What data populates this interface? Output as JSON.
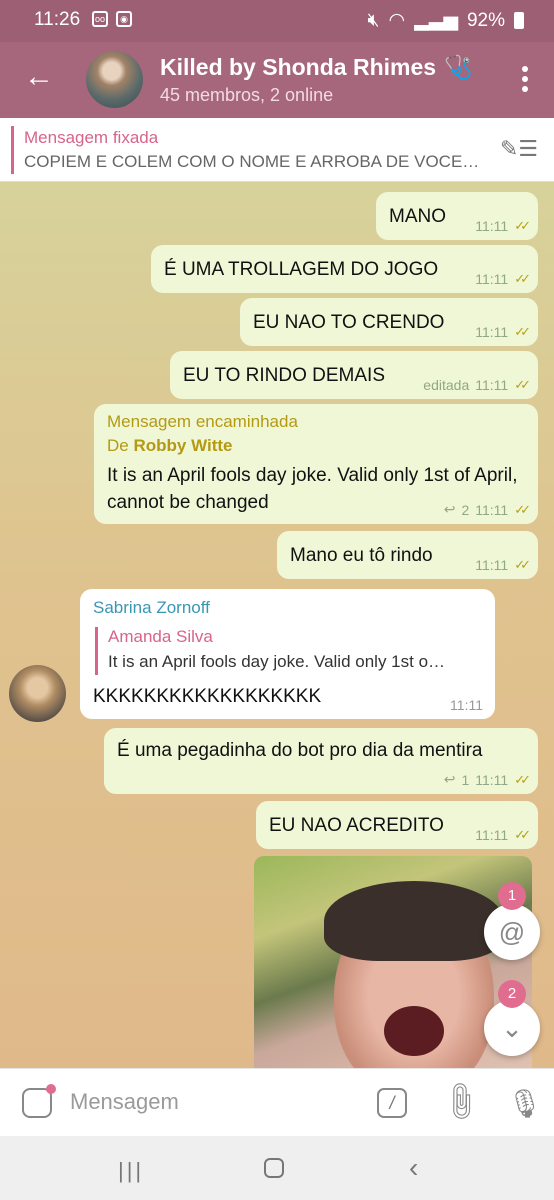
{
  "status_bar": {
    "time": "11:26",
    "battery": "92%"
  },
  "header": {
    "back_icon": "arrow-left-icon",
    "title": "Killed by Shonda Rhimes",
    "title_emoji": "🩺",
    "subtitle": "45 membros, 2 online"
  },
  "pinned": {
    "title": "Mensagem fixada",
    "text": "COPIEM E COLEM COM O NOME E ARROBA DE VOCE…"
  },
  "messages": [
    {
      "text": "MANO",
      "time": "11:11"
    },
    {
      "text": "É UMA TROLLAGEM DO JOGO",
      "time": "11:11"
    },
    {
      "text": "EU NAO TO CRENDO",
      "time": "11:11"
    },
    {
      "text": "EU TO RINDO DEMAIS",
      "edited": "editada",
      "time": "11:11"
    },
    {
      "forward_title": "Mensagem encaminhada",
      "forward_prefix": "De",
      "forward_from": "Robby Witte",
      "text": "It is an April fools day joke. Valid only 1st of April, cannot be changed",
      "replies": "2",
      "time": "11:11"
    },
    {
      "text": "Mano eu tô rindo",
      "time": "11:11"
    },
    {
      "sender": "Sabrina Zornoff",
      "reply_name": "Amanda Silva",
      "reply_text": "It is an April fools day joke. Valid only 1st o…",
      "text": "KKKKKKKKKKKKKKKKKK",
      "time": "11:11"
    },
    {
      "text": "É uma pegadinha do bot pro dia da mentira",
      "replies": "1",
      "time": "11:11"
    },
    {
      "text": "EU NAO ACREDITO",
      "time": "11:11"
    }
  ],
  "fabs": {
    "mentions_count": "1",
    "scroll_count": "2"
  },
  "input": {
    "placeholder": "Mensagem"
  }
}
